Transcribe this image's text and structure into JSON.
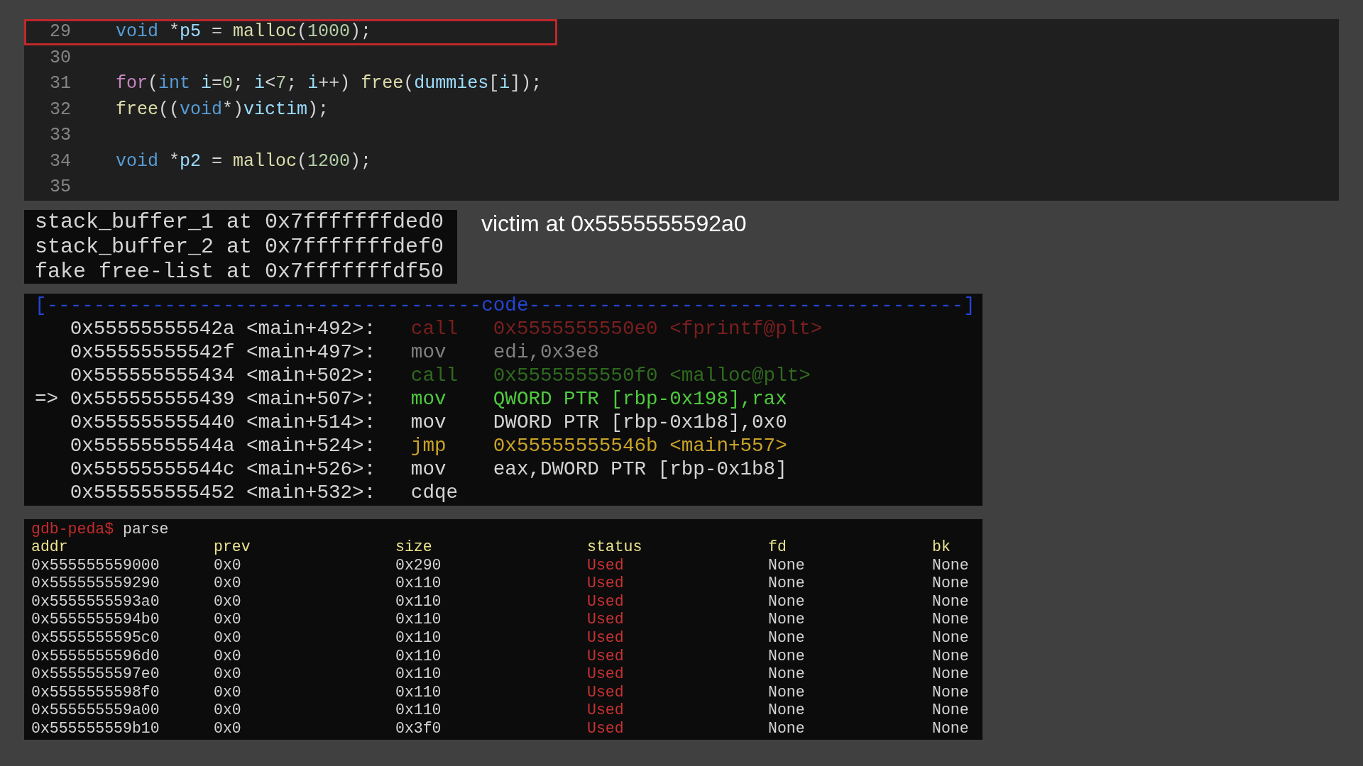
{
  "editor": {
    "lines": [
      {
        "number": "29",
        "highlighted": true,
        "tokens": [
          {
            "kind": "keyword",
            "text": "void"
          },
          {
            "kind": "plain",
            "text": " *"
          },
          {
            "kind": "variable",
            "text": "p5"
          },
          {
            "kind": "plain",
            "text": " = "
          },
          {
            "kind": "function",
            "text": "malloc"
          },
          {
            "kind": "plain",
            "text": "("
          },
          {
            "kind": "number",
            "text": "1000"
          },
          {
            "kind": "plain",
            "text": ");"
          }
        ]
      },
      {
        "number": "30",
        "highlighted": false
      },
      {
        "number": "31",
        "highlighted": false,
        "tokens": [
          {
            "kind": "control",
            "text": "for"
          },
          {
            "kind": "plain",
            "text": "("
          },
          {
            "kind": "keyword",
            "text": "int "
          },
          {
            "kind": "variable",
            "text": "i"
          },
          {
            "kind": "plain",
            "text": "="
          },
          {
            "kind": "number",
            "text": "0"
          },
          {
            "kind": "plain",
            "text": "; "
          },
          {
            "kind": "variable",
            "text": "i"
          },
          {
            "kind": "plain",
            "text": "<"
          },
          {
            "kind": "number",
            "text": "7"
          },
          {
            "kind": "plain",
            "text": "; "
          },
          {
            "kind": "variable",
            "text": "i"
          },
          {
            "kind": "plain",
            "text": "++) "
          },
          {
            "kind": "function",
            "text": "free"
          },
          {
            "kind": "plain",
            "text": "("
          },
          {
            "kind": "variable",
            "text": "dummies"
          },
          {
            "kind": "plain",
            "text": "["
          },
          {
            "kind": "variable",
            "text": "i"
          },
          {
            "kind": "plain",
            "text": "]);"
          }
        ]
      },
      {
        "number": "32",
        "highlighted": false,
        "tokens": [
          {
            "kind": "function",
            "text": "free"
          },
          {
            "kind": "plain",
            "text": "(("
          },
          {
            "kind": "keyword",
            "text": "void"
          },
          {
            "kind": "plain",
            "text": "*)"
          },
          {
            "kind": "variable",
            "text": "victim"
          },
          {
            "kind": "plain",
            "text": ");"
          }
        ]
      },
      {
        "number": "33",
        "highlighted": false
      },
      {
        "number": "34",
        "highlighted": false,
        "tokens": [
          {
            "kind": "keyword",
            "text": "void"
          },
          {
            "kind": "plain",
            "text": " *"
          },
          {
            "kind": "variable",
            "text": "p2"
          },
          {
            "kind": "plain",
            "text": " = "
          },
          {
            "kind": "function",
            "text": "malloc"
          },
          {
            "kind": "plain",
            "text": "("
          },
          {
            "kind": "number",
            "text": "1200"
          },
          {
            "kind": "plain",
            "text": ");"
          }
        ]
      },
      {
        "number": "35",
        "highlighted": false
      }
    ]
  },
  "stack_output": {
    "lines": [
      "stack_buffer_1 at 0x7fffffffded0",
      "stack_buffer_2 at 0x7fffffffdef0",
      "fake free-list at 0x7fffffffdf50"
    ]
  },
  "victim_note": "victim at 0x5555555592a0",
  "disassembly": {
    "header": "[-------------------------------------code-------------------------------------]",
    "instructions": [
      {
        "address": "0x55555555542a",
        "symbol": "<main+492>:",
        "mnemonic": "call",
        "operands": "0x5555555550e0 <fprintf@plt>",
        "color": "#7a1f1f"
      },
      {
        "address": "0x55555555542f",
        "symbol": "<main+497>:",
        "mnemonic": "mov",
        "operands": "edi,0x3e8",
        "color": "#808080"
      },
      {
        "address": "0x555555555434",
        "symbol": "<main+502>:",
        "mnemonic": "call",
        "operands": "0x5555555550f0 <malloc@plt>",
        "color": "#2f6a1f"
      },
      {
        "marker": "=>",
        "address": "0x555555555439",
        "symbol": "<main+507>:",
        "mnemonic": "mov",
        "operands": "QWORD PTR [rbp-0x198],rax",
        "color": "#4fc93f"
      },
      {
        "address": "0x555555555440",
        "symbol": "<main+514>:",
        "mnemonic": "mov",
        "operands": "DWORD PTR [rbp-0x1b8],0x0",
        "color": "#d4d4d4"
      },
      {
        "address": "0x55555555544a",
        "symbol": "<main+524>:",
        "mnemonic": "jmp",
        "operands": "0x55555555546b <main+557>",
        "color": "#c9a227"
      },
      {
        "address": "0x55555555544c",
        "symbol": "<main+526>:",
        "mnemonic": "mov",
        "operands": "eax,DWORD PTR [rbp-0x1b8]",
        "color": "#d4d4d4"
      },
      {
        "address": "0x555555555452",
        "symbol": "<main+532>:",
        "mnemonic": "cdqe",
        "color": "#d4d4d4"
      }
    ]
  },
  "heap_parse": {
    "prompt": "gdb-peda$",
    "command": "parse",
    "columns": [
      "addr",
      "prev",
      "size",
      "status",
      "fd",
      "bk"
    ],
    "rows": [
      {
        "addr": "0x555555559000",
        "prev": "0x0",
        "size": "0x290",
        "status": "Used",
        "fd": "None",
        "bk": "None"
      },
      {
        "addr": "0x555555559290",
        "prev": "0x0",
        "size": "0x110",
        "status": "Used",
        "fd": "None",
        "bk": "None"
      },
      {
        "addr": "0x5555555593a0",
        "prev": "0x0",
        "size": "0x110",
        "status": "Used",
        "fd": "None",
        "bk": "None"
      },
      {
        "addr": "0x5555555594b0",
        "prev": "0x0",
        "size": "0x110",
        "status": "Used",
        "fd": "None",
        "bk": "None"
      },
      {
        "addr": "0x5555555595c0",
        "prev": "0x0",
        "size": "0x110",
        "status": "Used",
        "fd": "None",
        "bk": "None"
      },
      {
        "addr": "0x5555555596d0",
        "prev": "0x0",
        "size": "0x110",
        "status": "Used",
        "fd": "None",
        "bk": "None"
      },
      {
        "addr": "0x5555555597e0",
        "prev": "0x0",
        "size": "0x110",
        "status": "Used",
        "fd": "None",
        "bk": "None"
      },
      {
        "addr": "0x5555555598f0",
        "prev": "0x0",
        "size": "0x110",
        "status": "Used",
        "fd": "None",
        "bk": "None"
      },
      {
        "addr": "0x555555559a00",
        "prev": "0x0",
        "size": "0x110",
        "status": "Used",
        "fd": "None",
        "bk": "None"
      },
      {
        "addr": "0x555555559b10",
        "prev": "0x0",
        "size": "0x3f0",
        "status": "Used",
        "fd": "None",
        "bk": "None"
      }
    ]
  }
}
